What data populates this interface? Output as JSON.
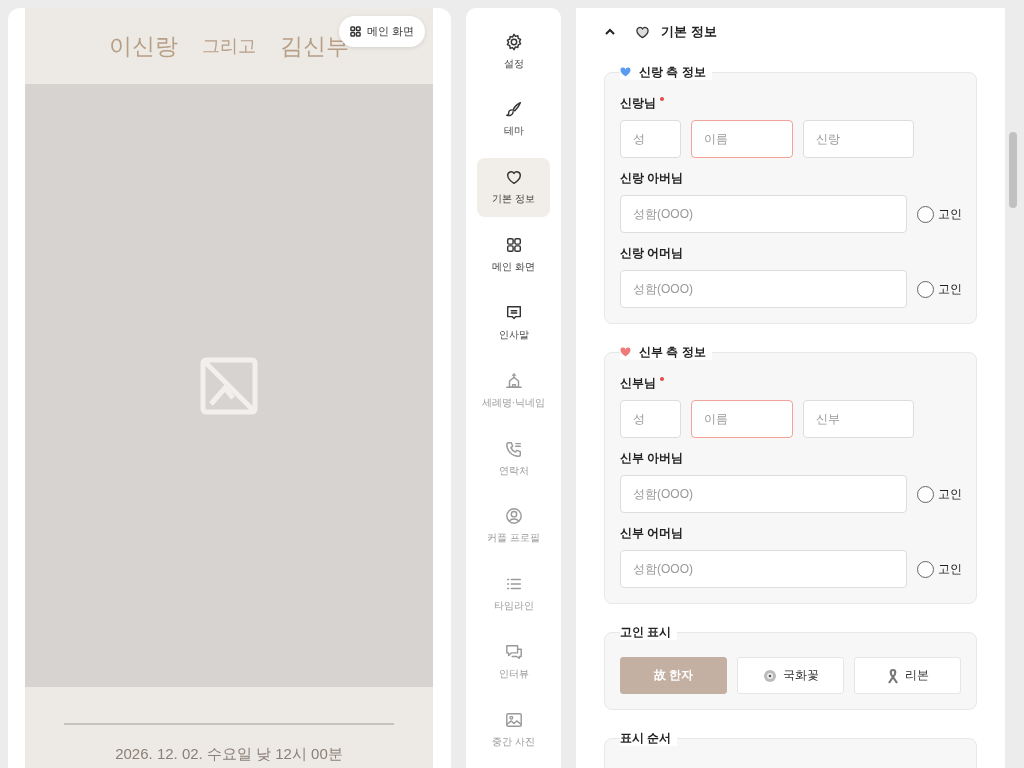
{
  "preview": {
    "groom": "이신랑",
    "conjunction": "그리고",
    "bride": "김신부",
    "main_button": "메인 화면",
    "date": "2026. 12. 02. 수요일 낮 12시 00분"
  },
  "nav": [
    {
      "label": "설정",
      "selected": false,
      "disabled": false
    },
    {
      "label": "테마",
      "selected": false,
      "disabled": false
    },
    {
      "label": "기본 정보",
      "selected": true,
      "disabled": false
    },
    {
      "label": "메인 화면",
      "selected": false,
      "disabled": false
    },
    {
      "label": "인사말",
      "selected": false,
      "disabled": false
    },
    {
      "label": "세례명·닉네임",
      "selected": false,
      "disabled": true
    },
    {
      "label": "연락처",
      "selected": false,
      "disabled": true
    },
    {
      "label": "커플 프로필",
      "selected": false,
      "disabled": true
    },
    {
      "label": "타임라인",
      "selected": false,
      "disabled": true
    },
    {
      "label": "인터뷰",
      "selected": false,
      "disabled": true
    },
    {
      "label": "중간 사진",
      "selected": false,
      "disabled": true
    }
  ],
  "section": {
    "title": "기본 정보",
    "expanded": true
  },
  "groups": [
    {
      "title": "신랑 측 정보",
      "color": "#5b9cf0",
      "rows": [
        {
          "kind": "name",
          "label": "신랑님",
          "required": true,
          "inputs": [
            {
              "placeholder": "성",
              "error": false
            },
            {
              "placeholder": "이름",
              "error": true
            },
            {
              "placeholder": "신랑",
              "error": false
            }
          ]
        },
        {
          "kind": "parent",
          "label": "신랑 아버님",
          "inputs": [
            {
              "placeholder": "성함(OOO)",
              "error": false
            }
          ],
          "deceased": {
            "label": "고인",
            "checked": false
          }
        },
        {
          "kind": "parent",
          "label": "신랑 어머님",
          "inputs": [
            {
              "placeholder": "성함(OOO)",
              "error": false
            }
          ],
          "deceased": {
            "label": "고인",
            "checked": false
          }
        }
      ]
    },
    {
      "title": "신부 측 정보",
      "color": "#f07a7a",
      "rows": [
        {
          "kind": "name",
          "label": "신부님",
          "required": true,
          "inputs": [
            {
              "placeholder": "성",
              "error": false
            },
            {
              "placeholder": "이름",
              "error": true
            },
            {
              "placeholder": "신부",
              "error": false
            }
          ]
        },
        {
          "kind": "parent",
          "label": "신부 아버님",
          "inputs": [
            {
              "placeholder": "성함(OOO)",
              "error": false
            }
          ],
          "deceased": {
            "label": "고인",
            "checked": false
          }
        },
        {
          "kind": "parent",
          "label": "신부 어머님",
          "inputs": [
            {
              "placeholder": "성함(OOO)",
              "error": false
            }
          ],
          "deceased": {
            "label": "고인",
            "checked": false
          }
        }
      ]
    }
  ],
  "deceased_display": {
    "title": "고인 표시",
    "options": [
      {
        "kind": "hanja",
        "label": "故 한자",
        "selected": true
      },
      {
        "kind": "flower",
        "label": "국화꽃",
        "selected": false
      },
      {
        "kind": "ribbon",
        "label": "리본",
        "selected": false
      }
    ]
  },
  "display_order": {
    "title": "표시 순서"
  }
}
